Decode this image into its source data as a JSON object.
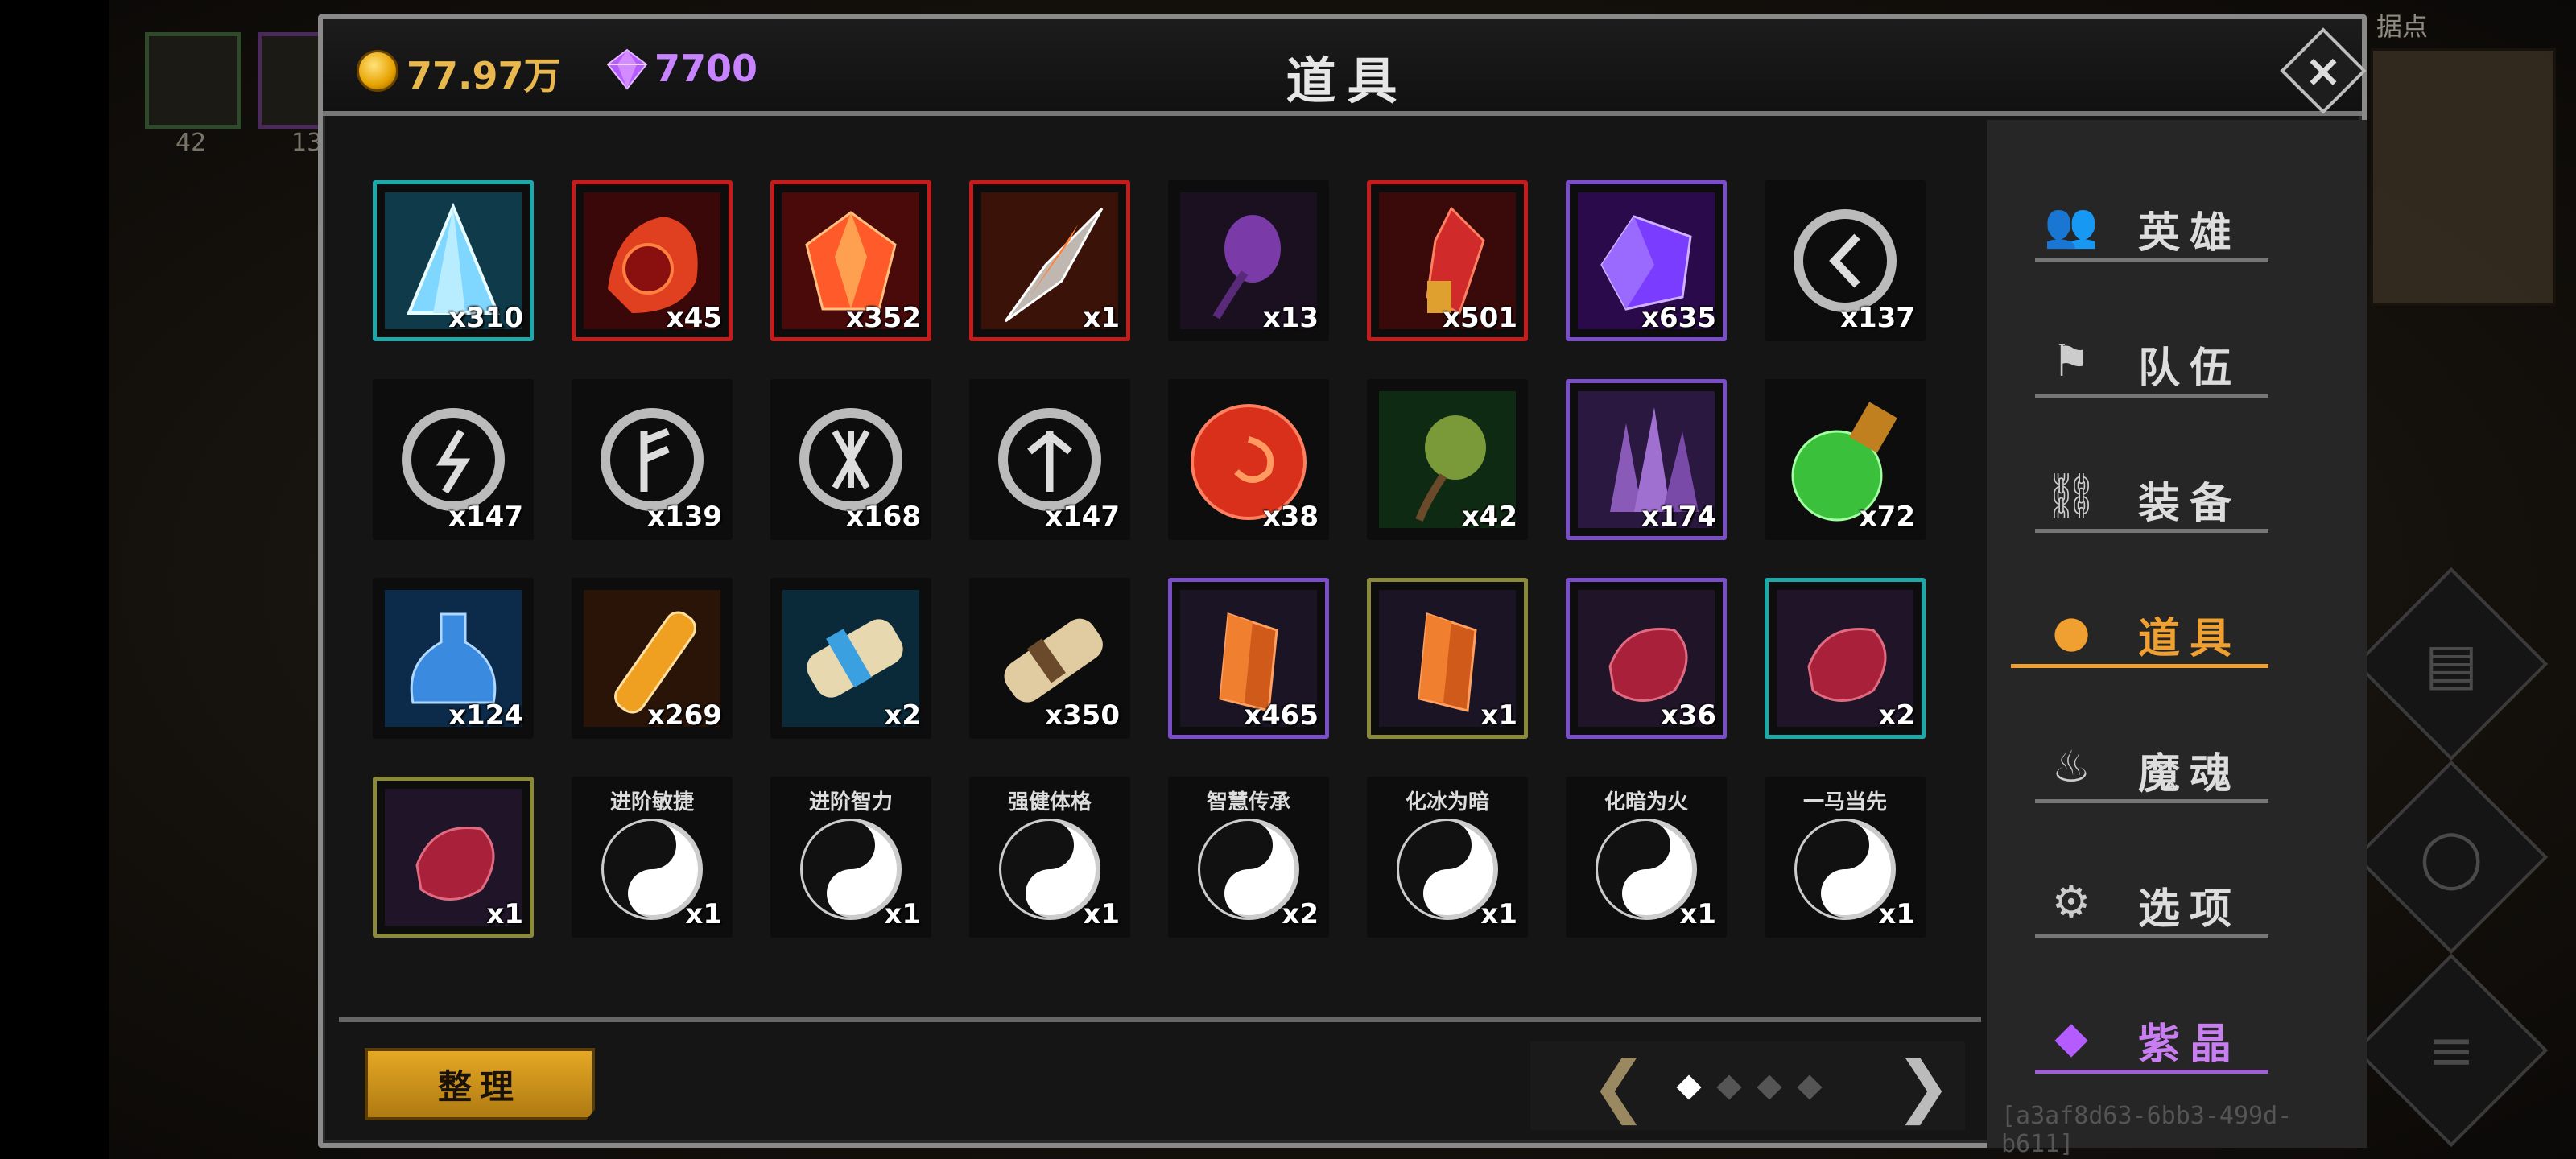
{
  "background": {
    "slot_counts": [
      "42",
      "13"
    ],
    "label": "据点"
  },
  "header": {
    "gold": "77.97万",
    "gems": "7700",
    "title": "道具",
    "close_label": "×"
  },
  "items": [
    {
      "qty": "x310",
      "rarity": "teal",
      "icon": "crystal-shard-icon",
      "label": ""
    },
    {
      "qty": "x45",
      "rarity": "red",
      "icon": "fire-orb-icon",
      "label": ""
    },
    {
      "qty": "x352",
      "rarity": "red",
      "icon": "red-gem-icon",
      "label": ""
    },
    {
      "qty": "x1",
      "rarity": "red",
      "icon": "spear-head-icon",
      "label": ""
    },
    {
      "qty": "x13",
      "rarity": "none",
      "icon": "purple-seed-icon",
      "label": ""
    },
    {
      "qty": "x501",
      "rarity": "red",
      "icon": "red-crystal-icon",
      "label": ""
    },
    {
      "qty": "x635",
      "rarity": "purple",
      "icon": "purple-gem-icon",
      "label": ""
    },
    {
      "qty": "x137",
      "rarity": "none",
      "icon": "rune-s-icon",
      "label": ""
    },
    {
      "qty": "x147",
      "rarity": "none",
      "icon": "rune-lightning-icon",
      "label": ""
    },
    {
      "qty": "x139",
      "rarity": "none",
      "icon": "rune-f-icon",
      "label": ""
    },
    {
      "qty": "x168",
      "rarity": "none",
      "icon": "rune-x-icon",
      "label": ""
    },
    {
      "qty": "x147",
      "rarity": "none",
      "icon": "rune-t-icon",
      "label": ""
    },
    {
      "qty": "x38",
      "rarity": "none",
      "icon": "swirl-orb-icon",
      "label": ""
    },
    {
      "qty": "x42",
      "rarity": "none",
      "icon": "green-seed-icon",
      "label": ""
    },
    {
      "qty": "x174",
      "rarity": "purple",
      "icon": "purple-shards-icon",
      "label": ""
    },
    {
      "qty": "x72",
      "rarity": "none",
      "icon": "green-potion-icon",
      "label": ""
    },
    {
      "qty": "x124",
      "rarity": "none",
      "icon": "blue-potion-icon",
      "label": ""
    },
    {
      "qty": "x269",
      "rarity": "none",
      "icon": "vial-icon",
      "label": ""
    },
    {
      "qty": "x2",
      "rarity": "none",
      "icon": "blue-scroll-icon",
      "label": ""
    },
    {
      "qty": "x350",
      "rarity": "none",
      "icon": "scroll-icon",
      "label": ""
    },
    {
      "qty": "x465",
      "rarity": "purple",
      "icon": "amber-crystal-icon",
      "label": ""
    },
    {
      "qty": "x1",
      "rarity": "olive",
      "icon": "amber-crystal-icon",
      "label": ""
    },
    {
      "qty": "x36",
      "rarity": "purple",
      "icon": "ruby-icon",
      "label": ""
    },
    {
      "qty": "x2",
      "rarity": "teal",
      "icon": "ruby-icon",
      "label": ""
    },
    {
      "qty": "x1",
      "rarity": "olive",
      "icon": "ruby-icon",
      "label": ""
    },
    {
      "qty": "x1",
      "rarity": "none",
      "icon": "yin-yang-icon",
      "label": "进阶敏捷"
    },
    {
      "qty": "x1",
      "rarity": "none",
      "icon": "yin-yang-icon",
      "label": "进阶智力"
    },
    {
      "qty": "x1",
      "rarity": "none",
      "icon": "yin-yang-icon",
      "label": "强健体格"
    },
    {
      "qty": "x2",
      "rarity": "none",
      "icon": "yin-yang-icon",
      "label": "智慧传承"
    },
    {
      "qty": "x1",
      "rarity": "none",
      "icon": "yin-yang-icon",
      "label": "化冰为暗"
    },
    {
      "qty": "x1",
      "rarity": "none",
      "icon": "yin-yang-icon",
      "label": "化暗为火"
    },
    {
      "qty": "x1",
      "rarity": "none",
      "icon": "yin-yang-icon",
      "label": "一马当先"
    }
  ],
  "footer": {
    "sort_label": "整理",
    "prev_label": "❮",
    "next_label": "❯",
    "page_current": 1,
    "page_total": 4
  },
  "tabs": [
    {
      "label": "英雄",
      "icon": "heroes-icon",
      "active": false
    },
    {
      "label": "队伍",
      "icon": "flag-icon",
      "active": false
    },
    {
      "label": "装备",
      "icon": "helmet-icon",
      "active": false
    },
    {
      "label": "道具",
      "icon": "bag-icon",
      "active": true
    },
    {
      "label": "魔魂",
      "icon": "flame-icon",
      "active": false
    },
    {
      "label": "选项",
      "icon": "gear-icon",
      "active": false
    },
    {
      "label": "紫晶",
      "icon": "purple-gem-icon",
      "active": false
    }
  ],
  "session_id": "[a3af8d63-6bb3-499d-b611]",
  "colors": {
    "gold": "#e8b84e",
    "gem": "#c884ff",
    "active_tab": "#f0a030",
    "rarity_teal": "#1fa8a8",
    "rarity_red": "#c41c1c",
    "rarity_purple": "#7a4ec8",
    "rarity_olive": "#8a8a3a"
  }
}
